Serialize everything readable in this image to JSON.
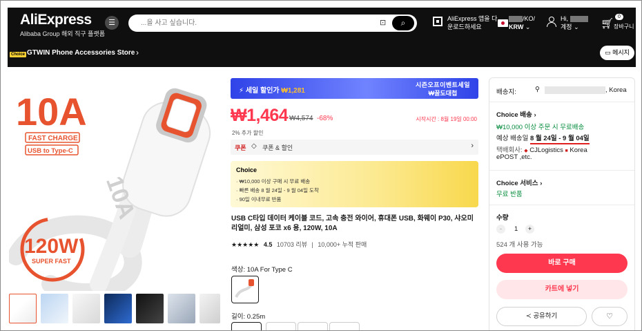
{
  "header": {
    "logo": "AliExpress",
    "logo_sub": "Alibaba Group 해외 직구 플랫폼",
    "search_placeholder": "...을 사고 싶습니다.",
    "app_line1": "AliExpress 앱을 다",
    "app_line2": "운로드하세요",
    "region_code": "/KO/",
    "currency": "KRW",
    "greeting": "Hi,",
    "account": "계정",
    "cart_count": "0",
    "cart_label": "장바구니"
  },
  "store": {
    "choice_tag": "Choice",
    "name": "GTWIN Phone Accessories Store",
    "message_button": "메시지"
  },
  "gallery": {
    "hero_big": "10A",
    "fast_charge": "FAST CHARGE",
    "usb_label": "USB to Type-C",
    "cable_mark": "10A",
    "watt": "120W",
    "super_fast": "SUPER FAST"
  },
  "product": {
    "sale_banner_label": "세일 할인가",
    "sale_banner_price": "₩1,281",
    "sale_event_line1": "시즌오프이벤트세일",
    "sale_event_line2": "₩꿀도대첩",
    "price": "₩1,464",
    "original_price": "₩4,574",
    "discount": "-68%",
    "start_time": "시작시간 : 8월 19일 00:00",
    "extra_discount": "2% 추가 할인",
    "coupon_tag": "쿠폰",
    "coupon_text": "쿠폰 & 할인",
    "choice_title": "Choice",
    "choice_lines": [
      "· ₩10,000 이상 구매 시 무료 배송",
      "· 빠른 배송 8 월 24일 - 9 월 04일 도착",
      "· 90일 이내무료 반품"
    ],
    "title": "USB C타입 데이터 케이블 코드, 고속 충전 와이어, 휴대폰 USB, 화웨이 P30, 샤오미 리얼미, 삼성 포코 x6 용, 120W, 10A",
    "stars": "★★★★★",
    "rating": "4.5",
    "reviews": "10703 리뷰",
    "sold": "10,000+ 누적 판매",
    "color_label": "색상: 10A For Type C",
    "length_label": "길이: 0.25m"
  },
  "sidebar": {
    "ship_to_label": "배송지:",
    "ship_to_country": ", Korea",
    "choice_shipping": "Choice 배송",
    "free_shipping": "₩10,000 이상 주문 시 무료배송",
    "est_label": "예상 배송일",
    "est_dates": "8 월 24일 - 9 월 04일",
    "courier_label": "택배회사:",
    "courier1": "CJLogistics",
    "courier2": "Korea",
    "courier3": "ePOST ,etc.",
    "choice_service": "Choice 서비스",
    "free_return": "무료 반품",
    "qty_label": "수량",
    "qty_minus": "-",
    "qty_value": "1",
    "qty_plus": "+",
    "available": "524 개 사용 가능",
    "buy_now": "바로 구매",
    "add_cart": "카트에 넣기",
    "share": "공유하기"
  },
  "colors": {
    "accent_red": "#fd384f",
    "brand_blue": "#2f43e8",
    "green": "#018a3a"
  }
}
